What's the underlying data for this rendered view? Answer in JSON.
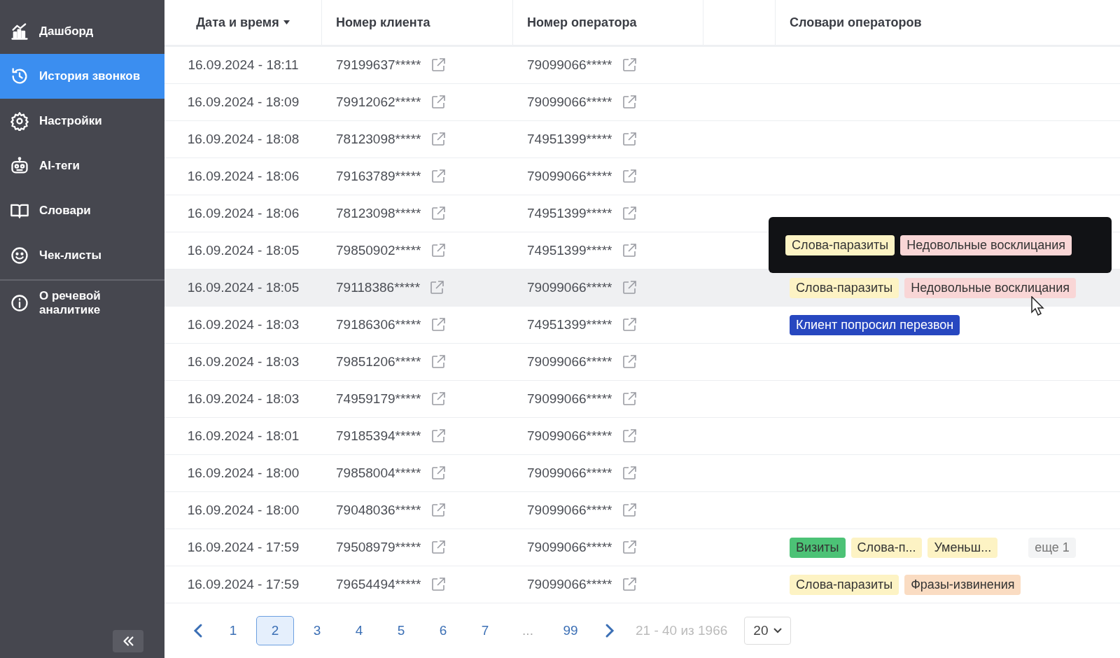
{
  "sidebar": {
    "items": [
      {
        "label": "Дашборд",
        "selected": false
      },
      {
        "label": "История звонков",
        "selected": true
      },
      {
        "label": "Настройки",
        "selected": false
      },
      {
        "label": "AI-теги",
        "selected": false
      },
      {
        "label": "Словари",
        "selected": false
      },
      {
        "label": "Чек-листы",
        "selected": false
      }
    ],
    "footer_items": [
      {
        "label": "О речевой аналитике",
        "selected": false
      }
    ]
  },
  "table": {
    "columns": [
      {
        "label": "Дата и время",
        "sorted": true
      },
      {
        "label": "Номер клиента",
        "sorted": false
      },
      {
        "label": "Номер оператора",
        "sorted": false
      },
      {
        "label": "Словари операторов",
        "sorted": false
      }
    ],
    "rows": [
      {
        "datetime": "16.09.2024 - 18:11",
        "client": "79199637*****",
        "operator": "79099066*****",
        "highlighted": false,
        "tags": []
      },
      {
        "datetime": "16.09.2024 - 18:09",
        "client": "79912062*****",
        "operator": "79099066*****",
        "highlighted": false,
        "tags": []
      },
      {
        "datetime": "16.09.2024 - 18:08",
        "client": "78123098*****",
        "operator": "74951399*****",
        "highlighted": false,
        "tags": []
      },
      {
        "datetime": "16.09.2024 - 18:06",
        "client": "79163789*****",
        "operator": "79099066*****",
        "highlighted": false,
        "tags": []
      },
      {
        "datetime": "16.09.2024 - 18:06",
        "client": "78123098*****",
        "operator": "74951399*****",
        "highlighted": false,
        "tags": []
      },
      {
        "datetime": "16.09.2024 - 18:05",
        "client": "79850902*****",
        "operator": "74951399*****",
        "highlighted": false,
        "tags": []
      },
      {
        "datetime": "16.09.2024 - 18:05",
        "client": "79118386*****",
        "operator": "79099066*****",
        "highlighted": true,
        "tags": [
          {
            "label": "Слова-паразиты",
            "color": "#fdf3c4"
          },
          {
            "label": "Недовольные восклицания",
            "color": "#f9d6d6"
          }
        ],
        "tooltip": {
          "tags": [
            {
              "label": "Слова-паразиты",
              "color": "#fdf3c4"
            },
            {
              "label": "Недовольные восклицания",
              "color": "#f9d6d6"
            }
          ]
        }
      },
      {
        "datetime": "16.09.2024 - 18:03",
        "client": "79186306*****",
        "operator": "74951399*****",
        "highlighted": false,
        "tags": [
          {
            "label": "Клиент попросил перезвон",
            "color": "#2747c0"
          }
        ]
      },
      {
        "datetime": "16.09.2024 - 18:03",
        "client": "79851206*****",
        "operator": "79099066*****",
        "highlighted": false,
        "tags": []
      },
      {
        "datetime": "16.09.2024 - 18:03",
        "client": "74959179*****",
        "operator": "79099066*****",
        "highlighted": false,
        "tags": []
      },
      {
        "datetime": "16.09.2024 - 18:01",
        "client": "79185394*****",
        "operator": "79099066*****",
        "highlighted": false,
        "tags": []
      },
      {
        "datetime": "16.09.2024 - 18:00",
        "client": "79858004*****",
        "operator": "79099066*****",
        "highlighted": false,
        "tags": []
      },
      {
        "datetime": "16.09.2024 - 18:00",
        "client": "79048036*****",
        "operator": "79099066*****",
        "highlighted": false,
        "tags": []
      },
      {
        "datetime": "16.09.2024 - 17:59",
        "client": "79508979*****",
        "operator": "79099066*****",
        "highlighted": false,
        "tags": [
          {
            "label": "Визиты",
            "color": "#4cc276"
          },
          {
            "label": "Слова-п...",
            "color": "#fdf3c4"
          },
          {
            "label": "Уменьш...",
            "color": "#fdf3c4"
          }
        ],
        "more": "еще 1"
      },
      {
        "datetime": "16.09.2024 - 17:59",
        "client": "79654494*****",
        "operator": "79099066*****",
        "highlighted": false,
        "tags": [
          {
            "label": "Слова-паразиты",
            "color": "#fdf3c4"
          },
          {
            "label": "Фразы-извинения",
            "color": "#fadcc2"
          }
        ]
      }
    ]
  },
  "pagination": {
    "pages": [
      {
        "label": "1",
        "kind": "page",
        "selected": false
      },
      {
        "label": "2",
        "kind": "page",
        "selected": true
      },
      {
        "label": "3",
        "kind": "page",
        "selected": false
      },
      {
        "label": "4",
        "kind": "page",
        "selected": false
      },
      {
        "label": "5",
        "kind": "page",
        "selected": false
      },
      {
        "label": "6",
        "kind": "page",
        "selected": false
      },
      {
        "label": "7",
        "kind": "page",
        "selected": false
      },
      {
        "label": "...",
        "kind": "ellipsis"
      },
      {
        "label": "99",
        "kind": "page",
        "selected": false
      }
    ],
    "range": "21 - 40 из 1966",
    "page_size": "20"
  }
}
